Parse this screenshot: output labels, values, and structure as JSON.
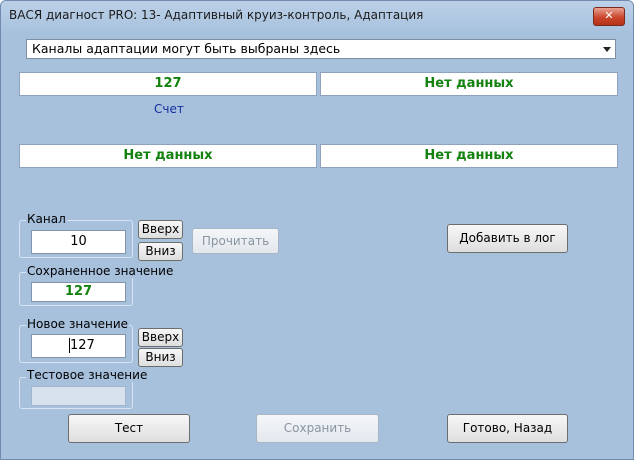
{
  "window": {
    "title": "ВАСЯ диагност PRO: 13- Адаптивный круиз-контроль, Адаптация",
    "close_glyph": "✕"
  },
  "channels_dropdown": {
    "selected": "Каналы адаптации могут быть выбраны здесь"
  },
  "values": {
    "top_left": "127",
    "top_left_caption": "Счет",
    "top_right": "Нет данных",
    "bottom_left": "Нет данных",
    "bottom_right": "Нет данных"
  },
  "channel": {
    "label": "Канал",
    "value": "10",
    "up_label": "Вверх",
    "down_label": "Вниз"
  },
  "read_button": "Прочитать",
  "add_log_button": "Добавить в лог",
  "saved_value": {
    "label": "Сохраненное значение",
    "value": "127"
  },
  "new_value": {
    "label": "Новое значение",
    "value": "127",
    "up_label": "Вверх",
    "down_label": "Вниз"
  },
  "test_value": {
    "label": "Тестовое значение"
  },
  "bottom_buttons": {
    "test": "Тест",
    "save": "Сохранить",
    "done": "Готово, Назад"
  },
  "colors": {
    "background": "#a7c1dd",
    "value_text": "#13820f",
    "caption_text": "#1530a0"
  }
}
